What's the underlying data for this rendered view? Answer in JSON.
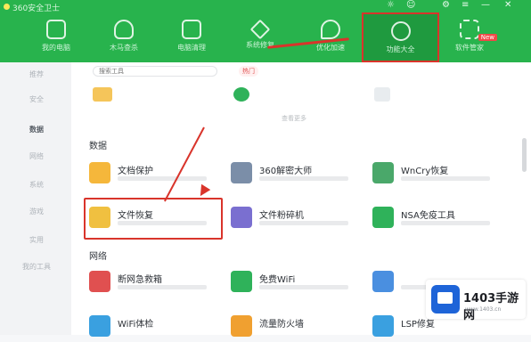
{
  "titlebar": {
    "text": "360安全卫士"
  },
  "window_controls": [
    "☼",
    "☺",
    "⚙",
    "≡",
    "—",
    "✕"
  ],
  "nav": {
    "items": [
      {
        "label": "我的电脑",
        "icon": "monitor-icon"
      },
      {
        "label": "木马查杀",
        "icon": "shield-icon"
      },
      {
        "label": "电脑清理",
        "icon": "broom-icon"
      },
      {
        "label": "系统修复",
        "icon": "wrench-icon"
      },
      {
        "label": "优化加速",
        "icon": "rocket-icon"
      },
      {
        "label": "功能大全",
        "icon": "toolbox-icon"
      },
      {
        "label": "软件管家",
        "icon": "apps-icon"
      }
    ],
    "badge": "New"
  },
  "sidebar": {
    "items": [
      "推荐",
      "安全",
      "数据",
      "网络",
      "系统",
      "游戏",
      "实用",
      "我的工具"
    ],
    "active": "数据"
  },
  "search": {
    "placeholder": "搜索工具",
    "chip": "热门"
  },
  "divider": {
    "label": "查看更多"
  },
  "sections": [
    {
      "title": "数据",
      "cards": [
        {
          "name": "文档保护",
          "color": "#f5b73b"
        },
        {
          "name": "360解密大师",
          "color": "#7b8ea8"
        },
        {
          "name": "WnCry恢复",
          "color": "#4aa86a"
        },
        {
          "name": "文件恢复",
          "color": "#f0c040"
        },
        {
          "name": "文件粉碎机",
          "color": "#7a6fd0"
        },
        {
          "name": "NSA免疫工具",
          "color": "#2fb25a"
        }
      ]
    },
    {
      "title": "网络",
      "cards": [
        {
          "name": "断网急救箱",
          "color": "#e05050"
        },
        {
          "name": "免费WiFi",
          "color": "#2fb25a"
        },
        {
          "name": "",
          "color": "#4a8fe0"
        },
        {
          "name": "WiFi体检",
          "color": "#3aa0e0"
        },
        {
          "name": "流量防火墙",
          "color": "#f0a030"
        },
        {
          "name": "LSP修复",
          "color": "#3aa0e0"
        }
      ]
    }
  ],
  "watermark": {
    "brand": "1403手游网",
    "url": "www.1403.cn"
  }
}
